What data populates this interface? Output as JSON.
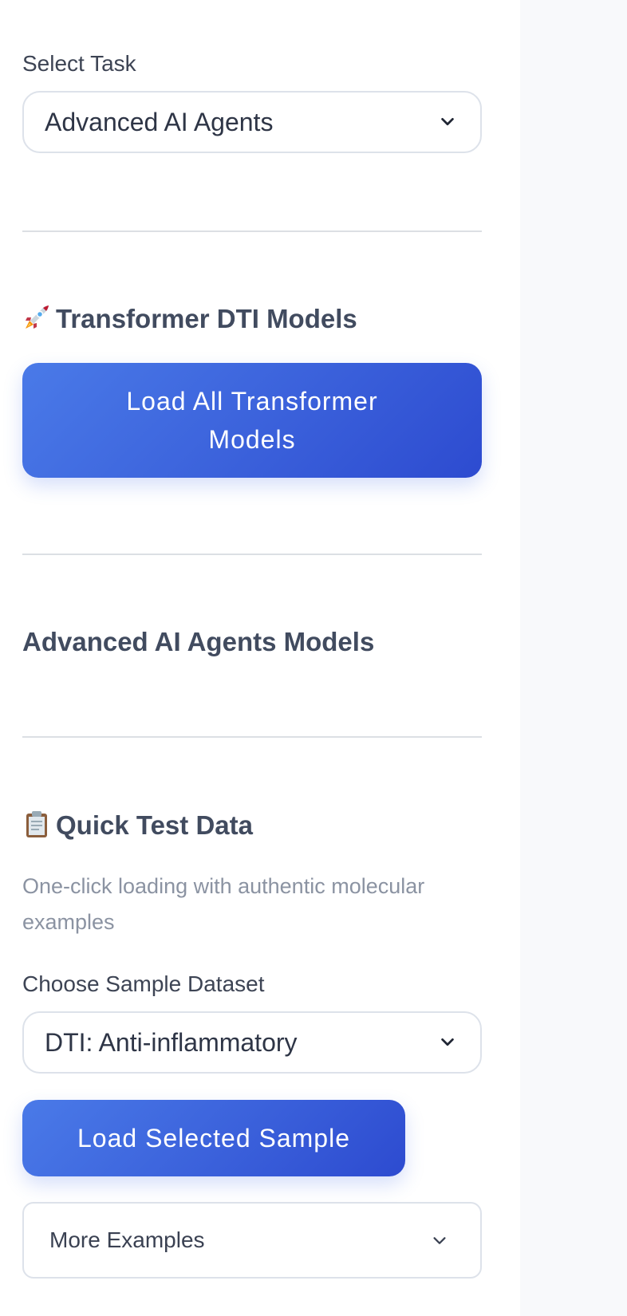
{
  "task": {
    "label": "Select Task",
    "selected": "Advanced AI Agents"
  },
  "transformer": {
    "heading": "Transformer DTI Models",
    "heading_icon": "rocket-icon",
    "button_line1": "Load All Transformer",
    "button_line2": "Models"
  },
  "agents": {
    "heading": "Advanced AI Agents Models"
  },
  "quick_test": {
    "heading": "Quick Test Data",
    "heading_icon": "clipboard-icon",
    "description": "One-click loading with authentic molecular examples",
    "sample_label": "Choose Sample Dataset",
    "sample_selected": "DTI: Anti-inflammatory",
    "load_button": "Load Selected Sample",
    "more_examples": "More Examples"
  },
  "colors": {
    "accent_start": "#4a7ae8",
    "accent_end": "#2d4bd0",
    "sidebar_bg": "#ffffff",
    "page_bg": "#f8f9fb"
  }
}
